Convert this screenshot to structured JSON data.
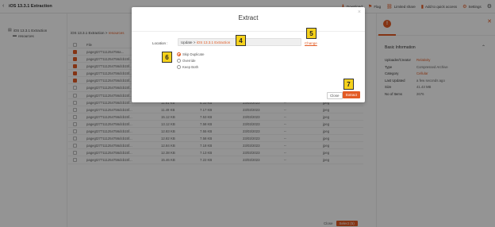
{
  "topbar": {
    "back_glyph": "‹",
    "title": "iOS 13.3.1 Extraction",
    "actions": [
      {
        "icon": "download-icon",
        "label": "Download"
      },
      {
        "icon": "flag-icon",
        "label": "Flag"
      },
      {
        "icon": "link-icon",
        "label": "Limited share"
      },
      {
        "icon": "bookmark-icon",
        "label": "Add to quick access"
      },
      {
        "icon": "gear-icon",
        "label": "Settings"
      }
    ]
  },
  "tree": {
    "root": "iOS 13.3.1 Extraction",
    "child": "resources"
  },
  "breadcrumb": {
    "parent": "iOS 13.3.1 Extraction",
    "sep": ">",
    "current": "resources"
  },
  "table": {
    "header_name": "File",
    "rows": [
      {
        "checked": true,
        "name": "pagegt277111254756a...",
        "csize": "",
        "size": "",
        "date": "",
        "dash": "",
        "type": ""
      },
      {
        "checked": true,
        "name": "pagegt277111254756dcb15f...",
        "csize": "",
        "size": "",
        "date": "",
        "dash": "",
        "type": ""
      },
      {
        "checked": true,
        "name": "pagegt277111254756dcb15f...",
        "csize": "",
        "size": "",
        "date": "",
        "dash": "",
        "type": ""
      },
      {
        "checked": true,
        "name": "pagegt277111254756dcb15f...",
        "csize": "",
        "size": "",
        "date": "",
        "dash": "",
        "type": ""
      },
      {
        "checked": true,
        "name": "pagegt277111254756dcb15f...",
        "csize": "",
        "size": "",
        "date": "",
        "dash": "",
        "type": ""
      },
      {
        "checked": false,
        "name": "pagegt277111254756dcb15f...",
        "csize": "11.37 KB",
        "size": "6.73 KB",
        "date": "23/03/2023",
        "dash": "--",
        "type": "jpeg"
      },
      {
        "checked": false,
        "name": "pagegt277111254756dcb15f...",
        "csize": "11.31 KB",
        "size": "6.73 KB",
        "date": "23/03/2023",
        "dash": "--",
        "type": "jpeg"
      },
      {
        "checked": false,
        "name": "pagegt277111254756dcb15f...",
        "csize": "11.91 KB",
        "size": "6.33 KB",
        "date": "23/03/2023",
        "dash": "--",
        "type": "jpeg"
      },
      {
        "checked": false,
        "name": "pagegt277111254756dcb15f...",
        "csize": "11.49 KB",
        "size": "7.17 KB",
        "date": "23/03/2023",
        "dash": "--",
        "type": "jpeg"
      },
      {
        "checked": false,
        "name": "pagegt277111254756dcb15f...",
        "csize": "15.12 KB",
        "size": "7.53 KB",
        "date": "23/03/2023",
        "dash": "--",
        "type": "jpeg"
      },
      {
        "checked": false,
        "name": "pagegt277111254756dcb15f...",
        "csize": "13.12 KB",
        "size": "7.58 KB",
        "date": "23/03/2023",
        "dash": "--",
        "type": "jpeg"
      },
      {
        "checked": false,
        "name": "pagegt277111254756dcb15f...",
        "csize": "12.83 KB",
        "size": "7.55 KB",
        "date": "23/03/2023",
        "dash": "--",
        "type": "jpeg"
      },
      {
        "checked": false,
        "name": "pagegt277111254756dcb15f...",
        "csize": "12.82 KB",
        "size": "7.58 KB",
        "date": "23/03/2023",
        "dash": "--",
        "type": "jpeg"
      },
      {
        "checked": false,
        "name": "pagegt277111254756dcb15f...",
        "csize": "12.84 KB",
        "size": "7.18 KB",
        "date": "23/03/2023",
        "dash": "--",
        "type": "jpeg"
      },
      {
        "checked": false,
        "name": "pagegt277111254756dcb15f...",
        "csize": "12.38 KB",
        "size": "7.13 KB",
        "date": "23/03/2023",
        "dash": "--",
        "type": "jpeg"
      },
      {
        "checked": false,
        "name": "pagegt277111254756dcb15f...",
        "csize": "15.46 KB",
        "size": "7.22 KB",
        "date": "23/03/2023",
        "dash": "--",
        "type": "jpeg"
      }
    ]
  },
  "background_buttons": {
    "close": "Close",
    "extract": "Select (5)"
  },
  "panel": {
    "info_glyph": "!",
    "close_glyph": "✕",
    "section": "Basic Information",
    "chevron": "⌃",
    "rows": [
      {
        "k": "Uploader/Creator",
        "v": "Relativity",
        "accent": true
      },
      {
        "k": "Type",
        "v": "Compressed Archive",
        "accent": false
      },
      {
        "k": "Category",
        "v": "Cellular",
        "accent": true
      },
      {
        "k": "Last Updated",
        "v": "a few seconds ago",
        "accent": false
      },
      {
        "k": "Size",
        "v": "41.43 MB",
        "accent": false
      },
      {
        "k": "No of Items",
        "v": "2676",
        "accent": false
      }
    ]
  },
  "modal": {
    "title": "Extract",
    "close_glyph": "×",
    "location_label": "Location :",
    "path_root": "Update",
    "path_sep": ">",
    "path_dest": "iOS 13.3.1 Extraction",
    "change_label": "Change",
    "options": [
      {
        "label": "Skip Duplicate",
        "selected": true
      },
      {
        "label": "Override",
        "selected": false
      },
      {
        "label": "Keep Both",
        "selected": false
      }
    ],
    "close_label": "Close",
    "extract_label": "Extract"
  },
  "markers": {
    "m4": "4",
    "m5": "5",
    "m6": "6",
    "m7": "7"
  },
  "colors": {
    "accent": "#e35b24",
    "marker": "#f6d21c"
  }
}
